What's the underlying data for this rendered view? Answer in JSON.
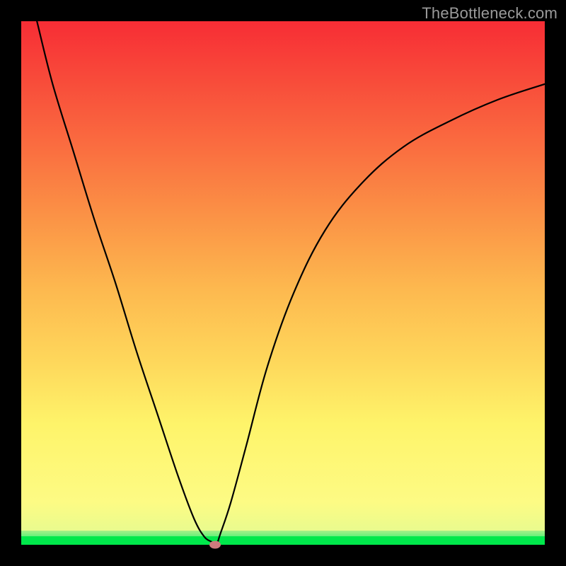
{
  "watermark": "TheBottleneck.com",
  "colors": {
    "frame": "#000000",
    "gradient_top": "#f72d35",
    "gradient_mid": "#fdb94f",
    "gradient_low": "#fdfb84",
    "gradient_bottom": "#00e84b",
    "curve": "#000000",
    "marker": "#cf7a7d"
  },
  "chart_data": {
    "type": "line",
    "title": "",
    "xlabel": "",
    "ylabel": "",
    "xlim": [
      0,
      100
    ],
    "ylim": [
      0,
      100
    ],
    "series": [
      {
        "name": "bottleneck-curve",
        "x": [
          3,
          6,
          10,
          14,
          18,
          22,
          26,
          30,
          33,
          35,
          36.5,
          37,
          37.5,
          38,
          40,
          43,
          47,
          52,
          58,
          65,
          73,
          82,
          91,
          100
        ],
        "values": [
          100,
          88,
          75,
          62,
          50,
          37,
          25,
          13,
          5,
          1.5,
          0.5,
          0,
          0.5,
          2,
          8,
          19,
          34,
          48,
          60,
          69,
          76,
          81,
          85,
          88
        ]
      }
    ],
    "marker": {
      "x": 37,
      "y": 0
    },
    "grid": false,
    "legend": false
  }
}
